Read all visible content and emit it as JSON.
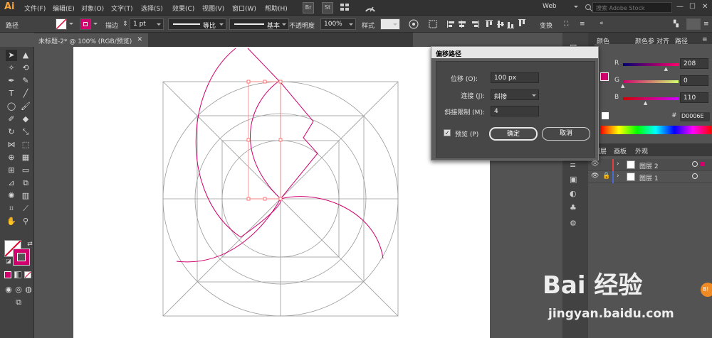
{
  "app": {
    "logo": "Ai"
  },
  "menu": [
    "文件(F)",
    "编辑(E)",
    "对象(O)",
    "文字(T)",
    "选择(S)",
    "效果(C)",
    "视图(V)",
    "窗口(W)",
    "帮助(H)"
  ],
  "menubar_icons": {
    "bridge": "Br",
    "stock": "St"
  },
  "workspace": "Web",
  "search_placeholder": "搜索 Adobe Stock",
  "control": {
    "selection_label": "路径",
    "stroke_label": "描边",
    "stroke_weight": "1 pt",
    "profile_label": "等比",
    "brush_label": "基本",
    "opacity_label": "不透明度",
    "opacity_value": "100%",
    "style_label": "样式",
    "transform_label": "变换"
  },
  "document_tab": "未标题-2* @ 100% (RGB/预览)",
  "panels": {
    "top_tabs": [
      "颜色",
      "颜色参",
      "对齐",
      "路径"
    ],
    "color": {
      "r_label": "R",
      "g_label": "G",
      "b_label": "B",
      "r": "208",
      "g": "0",
      "b": "110",
      "hex": "D0006E",
      "r_frac": 0.82,
      "g_frac": 0.0,
      "b_frac": 0.43
    },
    "layer_tabs": [
      "图层",
      "画板",
      "外观"
    ],
    "layers": [
      {
        "name": "图层 2"
      },
      {
        "name": "图层 1"
      }
    ]
  },
  "dialog": {
    "title": "偏移路径",
    "offset_label": "位移 (O):",
    "offset_value": "100 px",
    "joins_label": "连接 (J):",
    "joins_value": "斜接",
    "miter_label": "斜接限制 (M):",
    "miter_value": "4",
    "preview_label": "预览 (P)",
    "preview_checked": true,
    "ok_label": "确定",
    "cancel_label": "取消"
  },
  "watermark": {
    "brand": "Bai 经验",
    "url": "jingyan.baidu.com",
    "badge": "8!"
  },
  "colors": {
    "accent": "#D0006E",
    "menubar": "#323232",
    "ui": "#535353"
  }
}
